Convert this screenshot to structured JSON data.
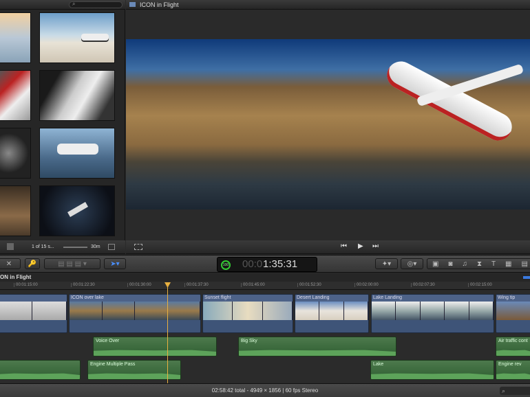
{
  "browser": {
    "status": "1 of 15 s...",
    "duration": "30m"
  },
  "viewer": {
    "title": "ICON in Flight"
  },
  "toolbar": {
    "timecode_prefix": "00:0",
    "timecode": "1:35:31",
    "percent": "100"
  },
  "timeline": {
    "title": "ICON in Flight",
    "ruler": [
      "00:01:15:00",
      "00:01:22:30",
      "00:01:30:00",
      "00:01:37:30",
      "00:01:45:00",
      "00:01:52:30",
      "00:02:00:00",
      "00:02:07:30",
      "00:02:15:00"
    ],
    "clips": [
      "ICON over lake",
      "Sunset flight",
      "Desert Landing",
      "Lake Landing",
      "Wing tip"
    ],
    "audio": [
      "Voice Over",
      "Big Sky",
      "Air traffic cont",
      "Engine Multiple Pass",
      "Lake",
      "Engine rev"
    ]
  },
  "status": {
    "summary": "02:58:42 total - 4949 × 1856 | 60 fps Stereo"
  },
  "colors": {
    "playhead": "#e8b040",
    "clip": "#3e5478",
    "audio": "#3f6e40"
  }
}
